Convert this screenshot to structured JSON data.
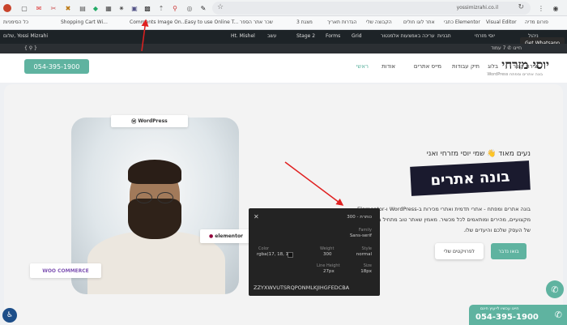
{
  "browser": {
    "url": "yossimizrahi.co.il",
    "extensions": [
      "record-icon",
      "page-icon",
      "gmail-icon",
      "tools-icon",
      "puzzle-icon",
      "chart-icon",
      "tag-icon",
      "devtools-icon",
      "star-pin-icon",
      "lock-icon",
      "edit-icon",
      "camera-icon",
      "pen-icon"
    ]
  },
  "bookmarks": [
    "כל הסימניות",
    "Shopping Cart Wi...",
    "Comments Image On...",
    "Easy to use Online T...",
    "שכר אתר הספר",
    "מצגת 3",
    "הגדרות תאריך",
    "הקבוצה שלי",
    "אתר לוגו חולים",
    "כתבי Elementor",
    "Visual Editor",
    "פורום מדיה"
  ],
  "wpbar": {
    "left_items": [
      "שלום, Yossi Mizrahi",
      "Ht. Mishel",
      "עשב",
      "Stage 2",
      "Forms",
      "Grid"
    ],
    "right_items": [
      "ניהול",
      "יוסי מזרחי",
      "עריכה באמצעות אלמנטור",
      "תבניות",
      "Forms"
    ]
  },
  "tooltip_chrome": "Get Whatsapp",
  "header": {
    "logo": "יוסי מזרחי",
    "logo_sub": "בונה אתרים ומפתח WordPress",
    "nav": [
      "ראשי",
      "אודות",
      "מייס אתרים",
      "תיק עבודות",
      "בלוג",
      "יצירת קשר"
    ],
    "phone_button": "054-395-1900",
    "topbar_note": "חייגו ✆ 7 עמוד"
  },
  "hero": {
    "greeting": "נעים מאוד 👋 שמי יוסי מזרחי ואני",
    "title": "בונה אתרים",
    "description": "בונה אתרים ומפתח - אתרי תדמית ואתרי מכירות ב-WordPress ו-Elementor, מקצועיים, מהירים ומותאמים לכל מכשיר. מאמין שאתר טוב מתחיל בהבנה עמוקה של העסק שלכם והיעדים שלו.",
    "primary_button": "בואו נדבר",
    "secondary_button": "לפרויקטים שלי"
  },
  "badges": {
    "wordpress": "WordPress",
    "elementor": "elementor",
    "woo": "WOO COMMERCE"
  },
  "inspector": {
    "title": "כותרת - 300",
    "family_label": "Family",
    "family_value": "Sans-serif",
    "style_label": "Style",
    "style_value": "normal",
    "weight_label": "Weight",
    "weight_value": "300",
    "color_label": "Color",
    "color_value": "rgba(17, 18, 18)",
    "size_label": "Size",
    "size_value": "18px",
    "lineheight_label": "Line Height",
    "lineheight_value": "27px",
    "sample": "ZZYXWVUTSRQPONMLKJIHGFEDCBA"
  },
  "floating": {
    "whatsapp_icon": "whatsapp-icon",
    "call_sub": "חייגו עכשיו לייעוץ חינם",
    "call_number": "054-395-1900",
    "accessibility_icon": "accessibility-icon"
  },
  "colors": {
    "accent": "#5fb3a0",
    "dark": "#1a1a2e",
    "wpbar": "#1d2327",
    "annotation": "#e02020"
  }
}
